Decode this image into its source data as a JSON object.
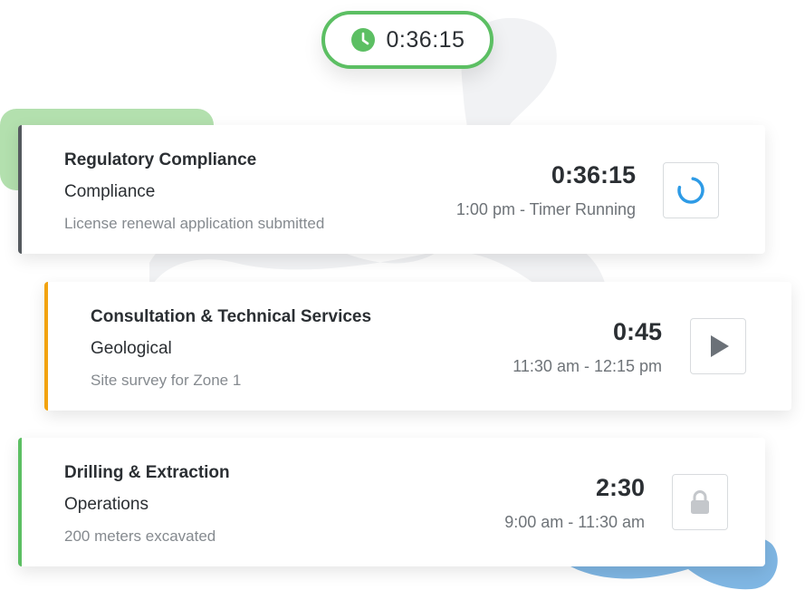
{
  "active_timer": {
    "time": "0:36:15",
    "icon": "clock-icon",
    "color": "#5cbf63"
  },
  "entries": [
    {
      "title": "Regulatory Compliance",
      "category": "Compliance",
      "description": "License renewal application submitted",
      "duration": "0:36:15",
      "time_range": "1:00 pm - Timer Running",
      "accent_color": "#555a5f",
      "action": "timer-running-spinner-icon"
    },
    {
      "title": "Consultation & Technical Services",
      "category": "Geological",
      "description": "Site survey for Zone 1",
      "duration": "0:45",
      "time_range": "11:30 am - 12:15 pm",
      "accent_color": "#f2a30f",
      "action": "play-icon"
    },
    {
      "title": "Drilling & Extraction",
      "category": "Operations",
      "description": "200 meters excavated",
      "duration": "2:30",
      "time_range": "9:00 am - 11:30 am",
      "accent_color": "#5cbf63",
      "action": "lock-icon"
    }
  ],
  "colors": {
    "spinner_blue": "#2e9be6",
    "decor_green": "#b3e0ae",
    "decor_blue": "#7fb6e3",
    "decor_grey": "#f1f2f4"
  }
}
